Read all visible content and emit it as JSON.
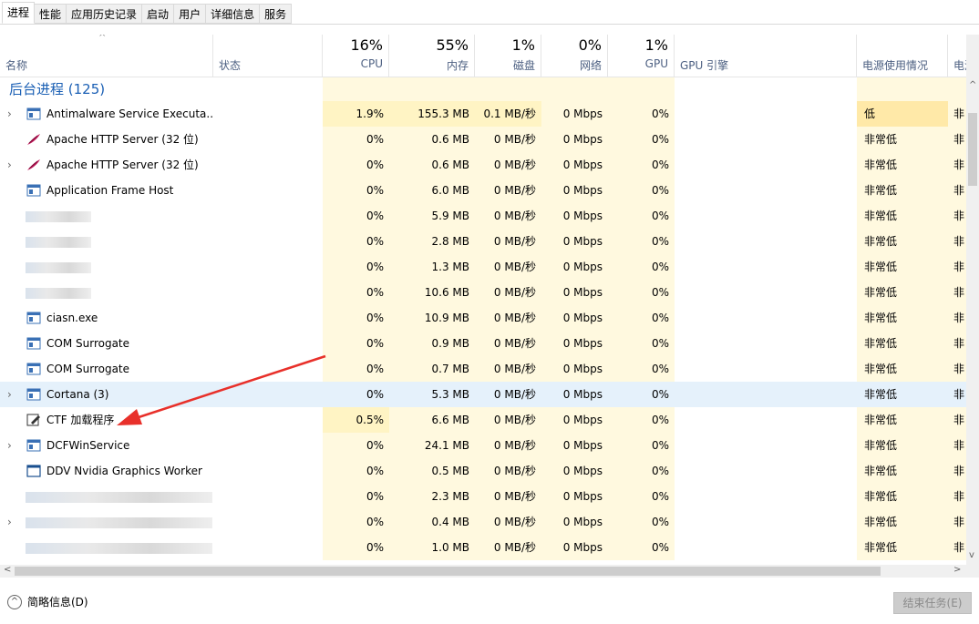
{
  "tabs": [
    "进程",
    "性能",
    "应用历史记录",
    "启动",
    "用户",
    "详细信息",
    "服务"
  ],
  "columns": {
    "name": "名称",
    "status": "状态",
    "cpu": {
      "pct": "16%",
      "label": "CPU"
    },
    "memory": {
      "pct": "55%",
      "label": "内存"
    },
    "disk": {
      "pct": "1%",
      "label": "磁盘"
    },
    "network": {
      "pct": "0%",
      "label": "网络"
    },
    "gpu": {
      "pct": "1%",
      "label": "GPU"
    },
    "gpu_engine": "GPU 引擎",
    "power": "电源使用情况",
    "power_trend": "电源"
  },
  "group_title": "后台进程 (125)",
  "rows": [
    {
      "name": "Antimalware Service Executa...",
      "expand": true,
      "icon": "window-icon",
      "cpu": "1.9%",
      "mem": "155.3 MB",
      "disk": "0.1 MB/秒",
      "net": "0 Mbps",
      "gpu": "0%",
      "power": "低",
      "trend": "非"
    },
    {
      "name": "Apache HTTP Server (32 位)",
      "expand": false,
      "icon": "apache-feather-icon",
      "cpu": "0%",
      "mem": "0.6 MB",
      "disk": "0 MB/秒",
      "net": "0 Mbps",
      "gpu": "0%",
      "power": "非常低",
      "trend": "非"
    },
    {
      "name": "Apache HTTP Server (32 位)",
      "expand": true,
      "icon": "apache-feather-icon",
      "cpu": "0%",
      "mem": "0.6 MB",
      "disk": "0 MB/秒",
      "net": "0 Mbps",
      "gpu": "0%",
      "power": "非常低",
      "trend": "非"
    },
    {
      "name": "Application Frame Host",
      "expand": false,
      "icon": "window-icon",
      "cpu": "0%",
      "mem": "6.0 MB",
      "disk": "0 MB/秒",
      "net": "0 Mbps",
      "gpu": "0%",
      "power": "非常低",
      "trend": "非"
    },
    {
      "name": "",
      "expand": false,
      "icon": "blurred",
      "cpu": "0%",
      "mem": "5.9 MB",
      "disk": "0 MB/秒",
      "net": "0 Mbps",
      "gpu": "0%",
      "power": "非常低",
      "trend": "非"
    },
    {
      "name": "",
      "expand": false,
      "icon": "blurred",
      "cpu": "0%",
      "mem": "2.8 MB",
      "disk": "0 MB/秒",
      "net": "0 Mbps",
      "gpu": "0%",
      "power": "非常低",
      "trend": "非"
    },
    {
      "name": "",
      "expand": false,
      "icon": "blurred",
      "cpu": "0%",
      "mem": "1.3 MB",
      "disk": "0 MB/秒",
      "net": "0 Mbps",
      "gpu": "0%",
      "power": "非常低",
      "trend": "非"
    },
    {
      "name": "",
      "expand": false,
      "icon": "blurred",
      "cpu": "0%",
      "mem": "10.6 MB",
      "disk": "0 MB/秒",
      "net": "0 Mbps",
      "gpu": "0%",
      "power": "非常低",
      "trend": "非"
    },
    {
      "name": "ciasn.exe",
      "expand": false,
      "icon": "window-icon",
      "cpu": "0%",
      "mem": "10.9 MB",
      "disk": "0 MB/秒",
      "net": "0 Mbps",
      "gpu": "0%",
      "power": "非常低",
      "trend": "非"
    },
    {
      "name": "COM Surrogate",
      "expand": false,
      "icon": "window-icon",
      "cpu": "0%",
      "mem": "0.9 MB",
      "disk": "0 MB/秒",
      "net": "0 Mbps",
      "gpu": "0%",
      "power": "非常低",
      "trend": "非"
    },
    {
      "name": "COM Surrogate",
      "expand": false,
      "icon": "window-icon",
      "cpu": "0%",
      "mem": "0.7 MB",
      "disk": "0 MB/秒",
      "net": "0 Mbps",
      "gpu": "0%",
      "power": "非常低",
      "trend": "非"
    },
    {
      "name": "Cortana (3)",
      "expand": true,
      "icon": "window-icon",
      "cpu": "0%",
      "mem": "5.3 MB",
      "disk": "0 MB/秒",
      "net": "0 Mbps",
      "gpu": "0%",
      "power": "非常低",
      "trend": "非"
    },
    {
      "name": "CTF 加载程序",
      "expand": false,
      "icon": "pen-icon",
      "cpu": "0.5%",
      "mem": "6.6 MB",
      "disk": "0 MB/秒",
      "net": "0 Mbps",
      "gpu": "0%",
      "power": "非常低",
      "trend": "非"
    },
    {
      "name": "DCFWinService",
      "expand": true,
      "icon": "window-icon",
      "cpu": "0%",
      "mem": "24.1 MB",
      "disk": "0 MB/秒",
      "net": "0 Mbps",
      "gpu": "0%",
      "power": "非常低",
      "trend": "非"
    },
    {
      "name": "DDV Nvidia Graphics Worker",
      "expand": false,
      "icon": "window-outline-icon",
      "cpu": "0%",
      "mem": "0.5 MB",
      "disk": "0 MB/秒",
      "net": "0 Mbps",
      "gpu": "0%",
      "power": "非常低",
      "trend": "非"
    },
    {
      "name": "",
      "expand": false,
      "icon": "blurred",
      "cpu": "0%",
      "mem": "2.3 MB",
      "disk": "0 MB/秒",
      "net": "0 Mbps",
      "gpu": "0%",
      "power": "非常低",
      "trend": "非"
    },
    {
      "name": "",
      "expand": true,
      "icon": "blurred",
      "cpu": "0%",
      "mem": "0.4 MB",
      "disk": "0 MB/秒",
      "net": "0 Mbps",
      "gpu": "0%",
      "power": "非常低",
      "trend": "非"
    },
    {
      "name": "",
      "expand": false,
      "icon": "blurred",
      "cpu": "0%",
      "mem": "1.0 MB",
      "disk": "0 MB/秒",
      "net": "0 Mbps",
      "gpu": "0%",
      "power": "非常低",
      "trend": "非"
    }
  ],
  "footer": {
    "fewer_details": "简略信息(D)",
    "end_task": "结束任务(E)"
  },
  "colors": {
    "heat_light": "#fff9df",
    "heat_mid": "#fff4c4",
    "heat_strong": "#ffe9a8",
    "selected_row": "#e5f1fb",
    "arrow": "#e8302a"
  }
}
